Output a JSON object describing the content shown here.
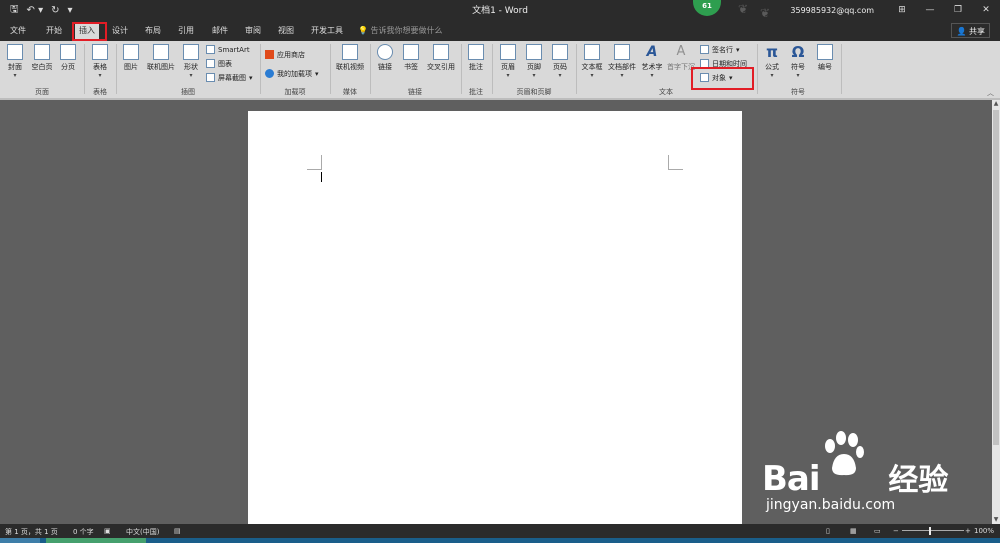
{
  "window": {
    "title": "文档1 - Word",
    "account": "359985932@qq.com",
    "badge": "61",
    "share": "共享",
    "tell_me": "告诉我你想要做什么"
  },
  "qat": {
    "save_icon": "save-icon",
    "undo_icon": "undo-icon",
    "redo_icon": "redo-icon",
    "customize_icon": "customize-icon"
  },
  "tabs": [
    "文件",
    "开始",
    "插入",
    "设计",
    "布局",
    "引用",
    "邮件",
    "审阅",
    "视图",
    "开发工具"
  ],
  "active_tab": "插入",
  "ribbon": {
    "buttons": [
      "封面",
      "空白页",
      "分页",
      "表格",
      "图片",
      "联机图片",
      "形状",
      "联机视频",
      "链接",
      "书签",
      "交叉引用",
      "批注",
      "页眉",
      "页脚",
      "页码",
      "文本框",
      "文档部件",
      "艺术字",
      "首字下沉",
      "公式",
      "符号",
      "编号"
    ],
    "small_buttons": [
      "SmartArt",
      "图表",
      "屏幕截图",
      "应用商店",
      "我的加载项",
      "签名行",
      "日期和时间",
      "对象"
    ],
    "groups": [
      "页面",
      "表格",
      "插图",
      "加载项",
      "媒体",
      "链接",
      "批注",
      "页眉和页脚",
      "文本",
      "符号"
    ]
  },
  "status": {
    "page": "第 1 页，共 1 页",
    "words": "0 个字",
    "language": "中文(中国)",
    "zoom": "100%"
  },
  "watermark": {
    "brand": "Bai",
    "brand2": "经验",
    "url": "jingyan.baidu.com"
  },
  "colors": {
    "highlight": "#e21d26",
    "ribbon": "#d9d9d9",
    "titlebar": "#2b2b2b"
  }
}
